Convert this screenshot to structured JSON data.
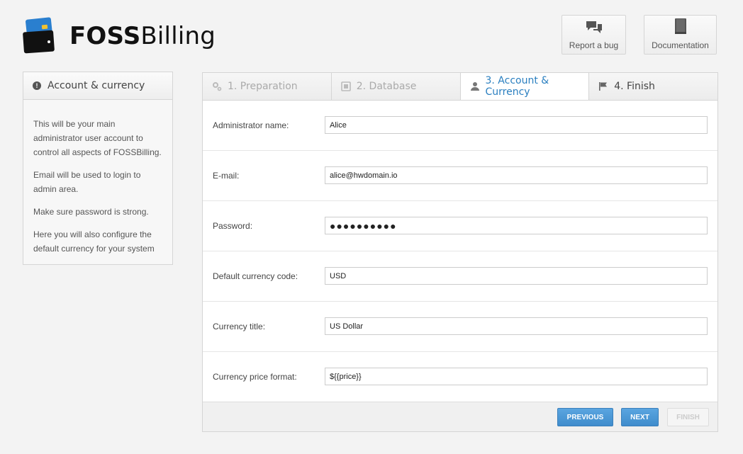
{
  "brand": {
    "bold": "FOSS",
    "light": "Billing"
  },
  "header_buttons": {
    "report_bug": {
      "label": "Report a bug",
      "icon": "speech-bubbles-icon"
    },
    "documentation": {
      "label": "Documentation",
      "icon": "book-icon"
    }
  },
  "sidebar": {
    "title": "Account & currency",
    "paragraphs": [
      "This will be your main administrator user account to control all aspects of FOSSBilling.",
      "Email will be used to login to admin area.",
      "Make sure password is strong.",
      "Here you will also configure the default currency for your system"
    ]
  },
  "tabs": [
    {
      "label": "1. Preparation",
      "icon": "gears-icon",
      "state": "done"
    },
    {
      "label": "2. Database",
      "icon": "database-icon",
      "state": "done"
    },
    {
      "label": "3. Account & Currency",
      "icon": "user-icon",
      "state": "active"
    },
    {
      "label": "4. Finish",
      "icon": "flag-icon",
      "state": "upcoming"
    }
  ],
  "form": {
    "admin_name": {
      "label": "Administrator name:",
      "value": "Alice"
    },
    "email": {
      "label": "E-mail:",
      "value": "alice@hwdomain.io"
    },
    "password": {
      "label": "Password:",
      "value": "●●●●●●●●●●"
    },
    "currency_code": {
      "label": "Default currency code:",
      "value": "USD"
    },
    "currency_title": {
      "label": "Currency title:",
      "value": "US Dollar"
    },
    "price_format": {
      "label": "Currency price format:",
      "value": "${{price}}"
    }
  },
  "actions": {
    "previous": "PREVIOUS",
    "next": "NEXT",
    "finish": "FINISH"
  },
  "colors": {
    "accent": "#2a7fc0",
    "button_blue": "#4a98d6"
  }
}
